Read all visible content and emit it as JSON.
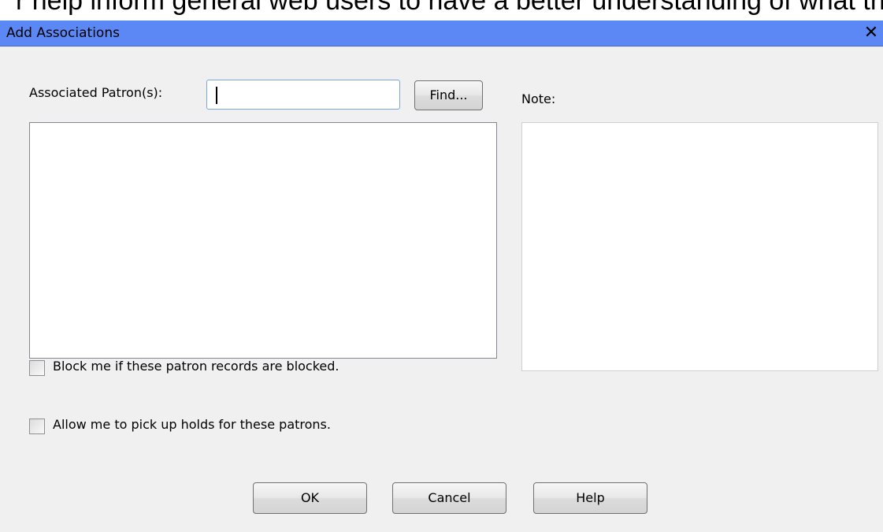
{
  "top_strip": {
    "text": "r help inform general web users to have a better understanding of what they are displaying. On a more technical level the "
  },
  "dialog": {
    "title": "Add Associations",
    "close_label": "✕"
  },
  "form": {
    "associated_patrons_label": "Associated Patron(s):",
    "associated_patrons_value": "",
    "find_button_label": "Find...",
    "note_label": "Note:",
    "block_checkbox_label": "Block me if these patron records are blocked.",
    "block_checkbox_checked": false,
    "pickup_checkbox_label": "Allow me to pick up holds for these patrons.",
    "pickup_checkbox_checked": false
  },
  "footer": {
    "ok_label": "OK",
    "cancel_label": "Cancel",
    "help_label": "Help"
  }
}
